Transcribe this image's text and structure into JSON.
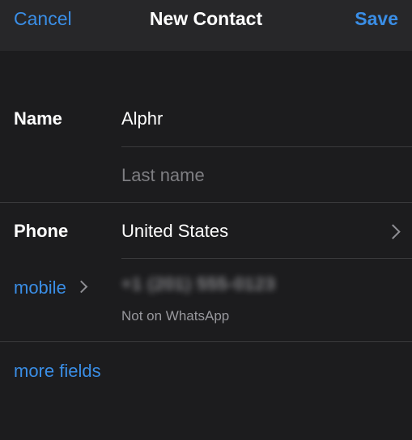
{
  "navbar": {
    "cancel_label": "Cancel",
    "title": "New Contact",
    "save_label": "Save"
  },
  "name_section": {
    "label": "Name",
    "first_name_value": "Alphr",
    "last_name_placeholder": "Last name"
  },
  "phone_section": {
    "label": "Phone",
    "country_value": "United States",
    "type_label": "mobile",
    "number_value": "+1 (201) 555-0123",
    "whatsapp_status": "Not on WhatsApp"
  },
  "more_fields_label": "more fields",
  "colors": {
    "accent": "#3a8ee6",
    "background": "#1c1c1e",
    "navbar": "#272729",
    "separator": "#3a3a3c",
    "placeholder": "#7e7e82"
  }
}
